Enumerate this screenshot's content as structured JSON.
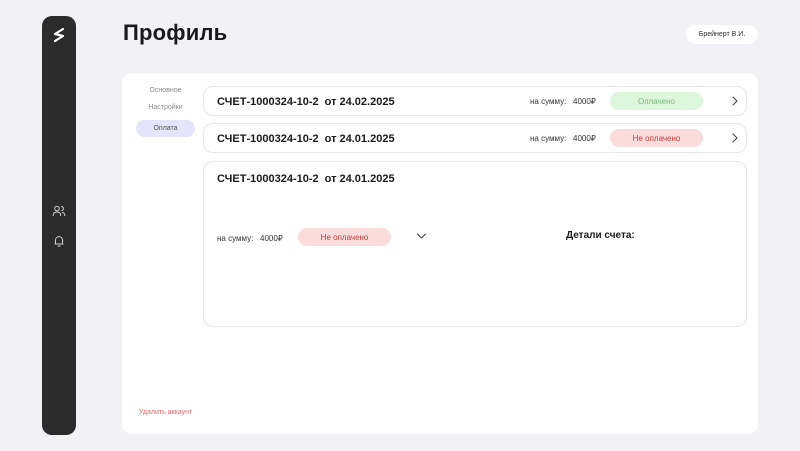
{
  "sidebar": {
    "logo_icon": "brand-logo-icon",
    "nav_icons": [
      "users-icon",
      "bell-icon"
    ]
  },
  "header": {
    "title": "Профиль",
    "user_name": "Брейнерт В.И."
  },
  "menu": {
    "items": [
      {
        "label": "Основное",
        "active": false
      },
      {
        "label": "Настройки",
        "active": false
      },
      {
        "label": "Оплата",
        "active": true
      }
    ],
    "delete_account": "Удалить аккаунт"
  },
  "invoices": [
    {
      "number": "СЧЕТ-1000324-10-2",
      "date": "от 24.02.2025",
      "sum_label": "на сумму:",
      "sum_value": "4000₽",
      "status": "Оплачено",
      "status_color": "#ddf7dd"
    },
    {
      "number": "СЧЕТ-1000324-10-2",
      "date": "от 24.01.2025",
      "sum_label": "на сумму:",
      "sum_value": "4000₽",
      "status": "Не оплачено",
      "status_color": "#fbdcdc"
    }
  ],
  "expanded_invoice": {
    "number": "СЧЕТ-1000324-10-2",
    "date": "от 24.01.2025",
    "sum_label": "на сумму:",
    "sum_value": "4000₽",
    "status": "Не оплачено",
    "details_title": "Детали счета:"
  }
}
